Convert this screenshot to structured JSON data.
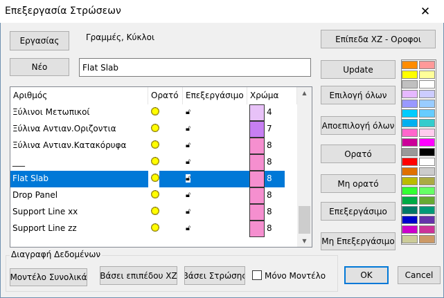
{
  "window": {
    "title": "Επεξεργασία Στρώσεων"
  },
  "top": {
    "tasks_button": "Εργασίας",
    "tasks_label": "Γραμμές, Κύκλοι",
    "new_button": "Νέο",
    "name_value": "Flat Slab"
  },
  "list": {
    "headers": {
      "number": "Αριθμός",
      "visible": "Ορατό",
      "editable": "Επεξεργάσιμο",
      "color": "Χρώμα"
    },
    "rows": [
      {
        "name": "Ξύλινοι Μετωπικοί",
        "color_num": "4",
        "color": "#e8c2f8",
        "selected": false
      },
      {
        "name": "Ξύλινα Αντιαν.Οριζοντια",
        "color_num": "7",
        "color": "#c77ff2",
        "selected": false
      },
      {
        "name": "Ξύλινα Αντιαν.Κατακόρυφα",
        "color_num": "8",
        "color": "#f58fcf",
        "selected": false
      },
      {
        "name": "___",
        "color_num": "8",
        "color": "#f58fcf",
        "selected": false
      },
      {
        "name": "Flat Slab",
        "color_num": "8",
        "color": "#f58fcf",
        "selected": true
      },
      {
        "name": "Drop Panel",
        "color_num": "8",
        "color": "#f58fcf",
        "selected": false
      },
      {
        "name": "Support Line xx",
        "color_num": "8",
        "color": "#f58fcf",
        "selected": false
      },
      {
        "name": "Support Line zz",
        "color_num": "8",
        "color": "#f58fcf",
        "selected": false
      }
    ]
  },
  "right": {
    "levels_button": "Επίπεδα XZ - Οροφοι",
    "update": "Update",
    "select_all": "Επιλογή όλων",
    "deselect_all": "Αποεπιλογή όλων",
    "visible": "Ορατό",
    "invisible": "Μη ορατό",
    "editable": "Επεξεργάσιμο",
    "non_editable": "Μη Επεξεργάσιμο"
  },
  "palette": [
    [
      "#ff8c00",
      "#ff9999"
    ],
    [
      "#ffff00",
      "#ffff99"
    ],
    [
      "#c0c0c0",
      "#ffffff"
    ],
    [
      "#e6b8ff",
      "#ccccff"
    ],
    [
      "#9999ff",
      "#99ccff"
    ],
    [
      "#00ccff",
      "#66ccff"
    ],
    [
      "#00b0f0",
      "#33cccc"
    ],
    [
      "#ff66cc",
      "#ffccee"
    ],
    [
      "#cc0099",
      "#ff00ff"
    ],
    [
      "#999999",
      "#000000"
    ],
    [
      "#ff0000",
      "#ffffff"
    ],
    [
      "#e07000",
      "#cccccc"
    ],
    [
      "#bbbb00",
      "#aaaa44"
    ],
    [
      "#33ff33",
      "#66ff66"
    ],
    [
      "#00aa44",
      "#66aa33"
    ],
    [
      "#007766",
      "#009977"
    ],
    [
      "#0000cc",
      "#6633aa"
    ],
    [
      "#cc00cc",
      "#cc3399"
    ],
    [
      "#cccc99",
      "#cc9966"
    ]
  ],
  "delete_group": {
    "title": "Διαγραφή Δεδομένων",
    "model_total": "Μοντέλο Συνολικά",
    "by_level": "Βάσει επιπέδου XZ",
    "by_layer": "Βάσει Στρώσης",
    "only_model": "Μόνο Μοντέλο"
  },
  "footer": {
    "ok": "OK",
    "cancel": "Cancel"
  }
}
